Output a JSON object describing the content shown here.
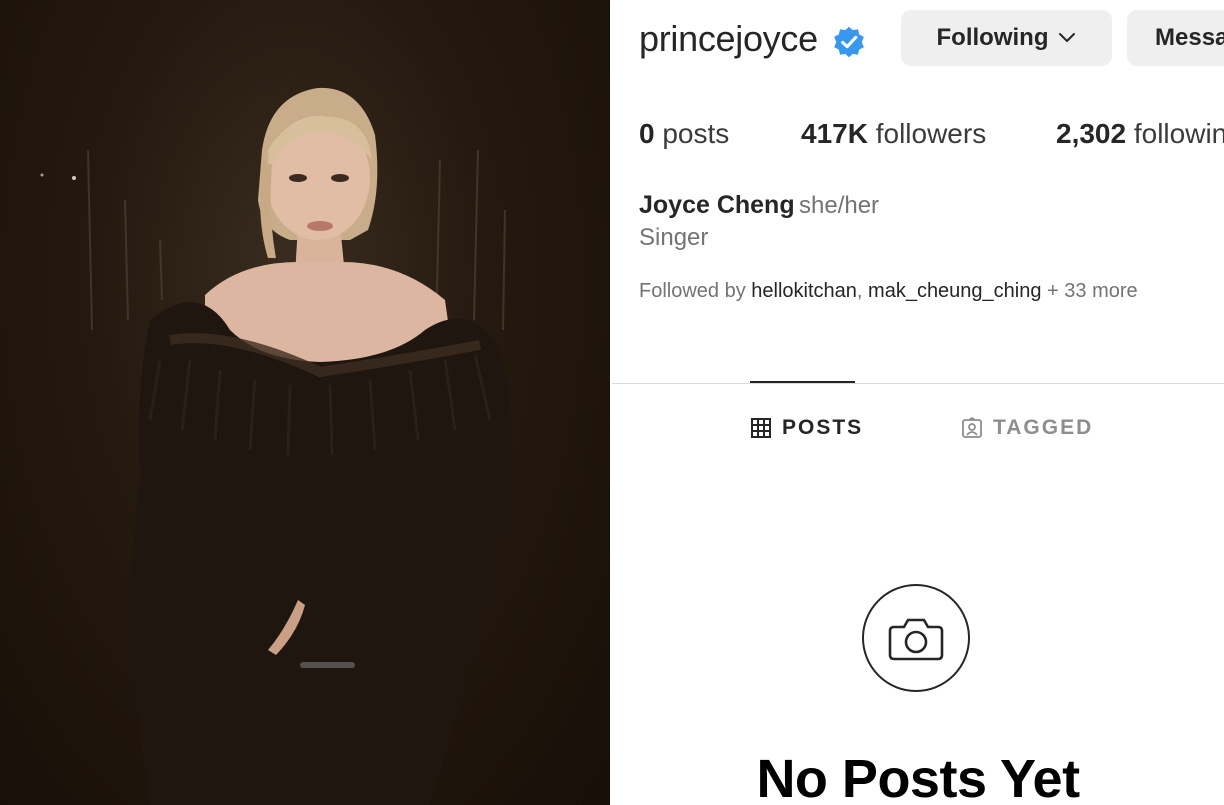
{
  "photo": {
    "description_icon": "person-portrait"
  },
  "profile": {
    "username": "princejoyce",
    "verified_icon": "verified-badge-icon",
    "accent_color": "#3897f0",
    "following_button": "Following",
    "message_button": "Messa",
    "stats": {
      "posts_count": "0",
      "posts_label": "posts",
      "followers_count": "417K",
      "followers_label": "followers",
      "following_count": "2,302",
      "following_label": "followin"
    },
    "full_name": "Joyce Cheng",
    "pronouns": "she/her",
    "bio": "Singer",
    "followed_by": {
      "prefix": "Followed by ",
      "account_1": "hellokitchan",
      "separator": ", ",
      "account_2": "mak_cheung_ching",
      "suffix": " + 33 more"
    },
    "tabs": [
      {
        "label": "POSTS",
        "icon": "grid-icon",
        "active": true
      },
      {
        "label": "TAGGED",
        "icon": "tagged-icon",
        "active": false
      }
    ],
    "empty_state": {
      "icon": "camera-icon",
      "title": "No Posts Yet"
    }
  }
}
